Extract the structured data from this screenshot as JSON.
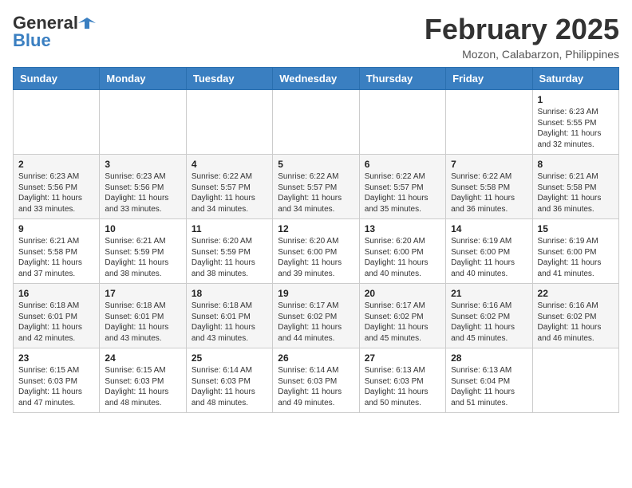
{
  "header": {
    "logo_general": "General",
    "logo_blue": "Blue",
    "month_year": "February 2025",
    "location": "Mozon, Calabarzon, Philippines"
  },
  "weekdays": [
    "Sunday",
    "Monday",
    "Tuesday",
    "Wednesday",
    "Thursday",
    "Friday",
    "Saturday"
  ],
  "weeks": [
    [
      {
        "day": "",
        "info": ""
      },
      {
        "day": "",
        "info": ""
      },
      {
        "day": "",
        "info": ""
      },
      {
        "day": "",
        "info": ""
      },
      {
        "day": "",
        "info": ""
      },
      {
        "day": "",
        "info": ""
      },
      {
        "day": "1",
        "info": "Sunrise: 6:23 AM\nSunset: 5:55 PM\nDaylight: 11 hours and 32 minutes."
      }
    ],
    [
      {
        "day": "2",
        "info": "Sunrise: 6:23 AM\nSunset: 5:56 PM\nDaylight: 11 hours and 33 minutes."
      },
      {
        "day": "3",
        "info": "Sunrise: 6:23 AM\nSunset: 5:56 PM\nDaylight: 11 hours and 33 minutes."
      },
      {
        "day": "4",
        "info": "Sunrise: 6:22 AM\nSunset: 5:57 PM\nDaylight: 11 hours and 34 minutes."
      },
      {
        "day": "5",
        "info": "Sunrise: 6:22 AM\nSunset: 5:57 PM\nDaylight: 11 hours and 34 minutes."
      },
      {
        "day": "6",
        "info": "Sunrise: 6:22 AM\nSunset: 5:57 PM\nDaylight: 11 hours and 35 minutes."
      },
      {
        "day": "7",
        "info": "Sunrise: 6:22 AM\nSunset: 5:58 PM\nDaylight: 11 hours and 36 minutes."
      },
      {
        "day": "8",
        "info": "Sunrise: 6:21 AM\nSunset: 5:58 PM\nDaylight: 11 hours and 36 minutes."
      }
    ],
    [
      {
        "day": "9",
        "info": "Sunrise: 6:21 AM\nSunset: 5:58 PM\nDaylight: 11 hours and 37 minutes."
      },
      {
        "day": "10",
        "info": "Sunrise: 6:21 AM\nSunset: 5:59 PM\nDaylight: 11 hours and 38 minutes."
      },
      {
        "day": "11",
        "info": "Sunrise: 6:20 AM\nSunset: 5:59 PM\nDaylight: 11 hours and 38 minutes."
      },
      {
        "day": "12",
        "info": "Sunrise: 6:20 AM\nSunset: 6:00 PM\nDaylight: 11 hours and 39 minutes."
      },
      {
        "day": "13",
        "info": "Sunrise: 6:20 AM\nSunset: 6:00 PM\nDaylight: 11 hours and 40 minutes."
      },
      {
        "day": "14",
        "info": "Sunrise: 6:19 AM\nSunset: 6:00 PM\nDaylight: 11 hours and 40 minutes."
      },
      {
        "day": "15",
        "info": "Sunrise: 6:19 AM\nSunset: 6:00 PM\nDaylight: 11 hours and 41 minutes."
      }
    ],
    [
      {
        "day": "16",
        "info": "Sunrise: 6:18 AM\nSunset: 6:01 PM\nDaylight: 11 hours and 42 minutes."
      },
      {
        "day": "17",
        "info": "Sunrise: 6:18 AM\nSunset: 6:01 PM\nDaylight: 11 hours and 43 minutes."
      },
      {
        "day": "18",
        "info": "Sunrise: 6:18 AM\nSunset: 6:01 PM\nDaylight: 11 hours and 43 minutes."
      },
      {
        "day": "19",
        "info": "Sunrise: 6:17 AM\nSunset: 6:02 PM\nDaylight: 11 hours and 44 minutes."
      },
      {
        "day": "20",
        "info": "Sunrise: 6:17 AM\nSunset: 6:02 PM\nDaylight: 11 hours and 45 minutes."
      },
      {
        "day": "21",
        "info": "Sunrise: 6:16 AM\nSunset: 6:02 PM\nDaylight: 11 hours and 45 minutes."
      },
      {
        "day": "22",
        "info": "Sunrise: 6:16 AM\nSunset: 6:02 PM\nDaylight: 11 hours and 46 minutes."
      }
    ],
    [
      {
        "day": "23",
        "info": "Sunrise: 6:15 AM\nSunset: 6:03 PM\nDaylight: 11 hours and 47 minutes."
      },
      {
        "day": "24",
        "info": "Sunrise: 6:15 AM\nSunset: 6:03 PM\nDaylight: 11 hours and 48 minutes."
      },
      {
        "day": "25",
        "info": "Sunrise: 6:14 AM\nSunset: 6:03 PM\nDaylight: 11 hours and 48 minutes."
      },
      {
        "day": "26",
        "info": "Sunrise: 6:14 AM\nSunset: 6:03 PM\nDaylight: 11 hours and 49 minutes."
      },
      {
        "day": "27",
        "info": "Sunrise: 6:13 AM\nSunset: 6:03 PM\nDaylight: 11 hours and 50 minutes."
      },
      {
        "day": "28",
        "info": "Sunrise: 6:13 AM\nSunset: 6:04 PM\nDaylight: 11 hours and 51 minutes."
      },
      {
        "day": "",
        "info": ""
      }
    ]
  ]
}
